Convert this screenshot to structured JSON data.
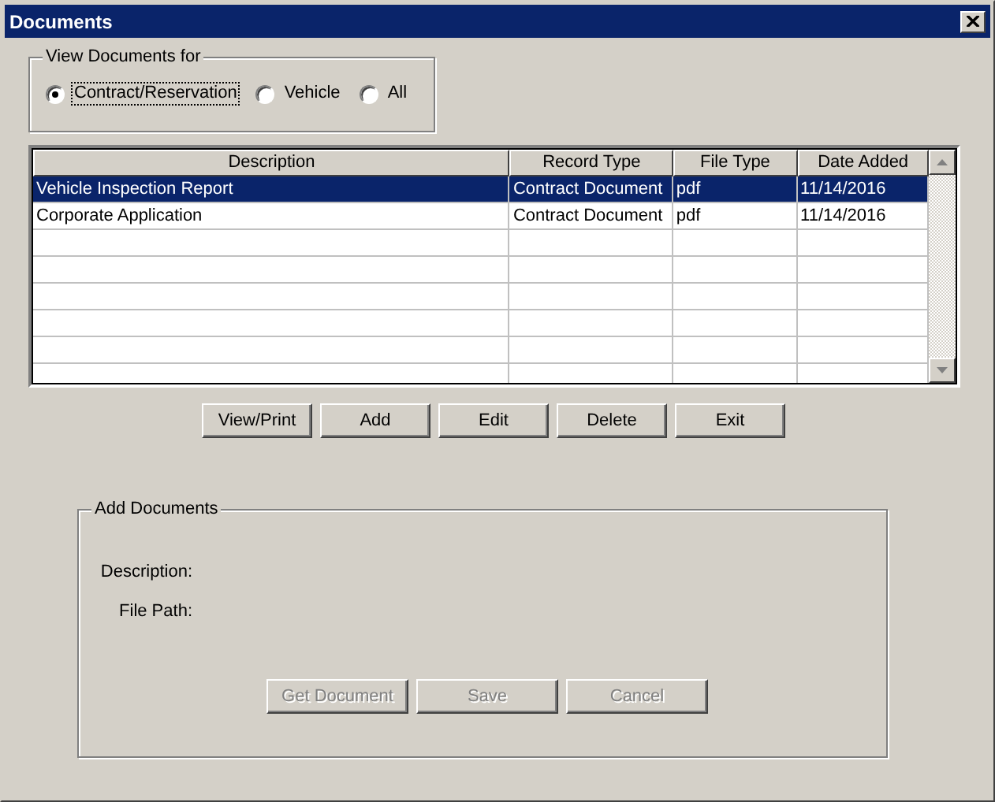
{
  "window": {
    "title": "Documents"
  },
  "view_for": {
    "legend": "View Documents for",
    "options": [
      {
        "label": "Contract/Reservation",
        "selected": true
      },
      {
        "label": "Vehicle",
        "selected": false
      },
      {
        "label": "All",
        "selected": false
      }
    ]
  },
  "table": {
    "columns": [
      "Description",
      "Record Type",
      "File Type",
      "Date Added"
    ],
    "rows": [
      {
        "cells": [
          "Vehicle Inspection Report",
          "Contract Document",
          "pdf",
          "11/14/2016"
        ],
        "selected": true
      },
      {
        "cells": [
          "Corporate Application",
          "Contract Document",
          "pdf",
          "11/14/2016"
        ],
        "selected": false
      }
    ]
  },
  "buttons": [
    {
      "label": "View/Print",
      "disabled": false
    },
    {
      "label": "Add",
      "disabled": false
    },
    {
      "label": "Edit",
      "disabled": false
    },
    {
      "label": "Delete",
      "disabled": false
    },
    {
      "label": "Exit",
      "disabled": false
    }
  ],
  "add_documents": {
    "legend": "Add Documents",
    "fields": [
      "Description:",
      "File Path:"
    ],
    "buttons": [
      {
        "label": "Get Document",
        "disabled": true
      },
      {
        "label": "Save",
        "disabled": true
      },
      {
        "label": "Cancel",
        "disabled": true
      }
    ]
  }
}
